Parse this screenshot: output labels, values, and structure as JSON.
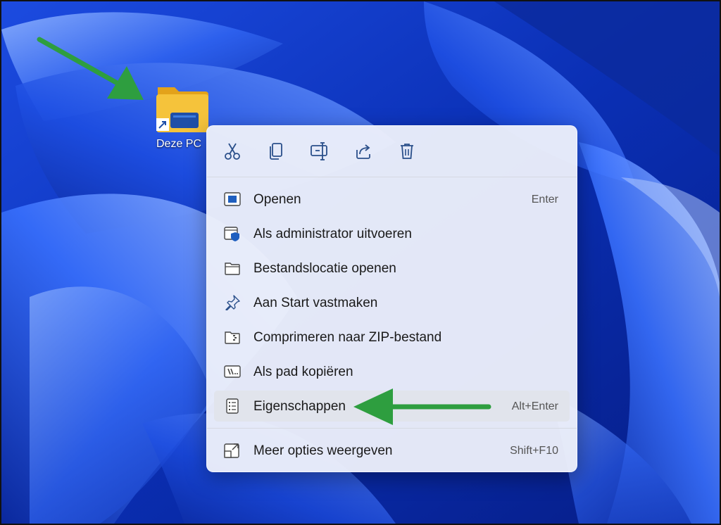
{
  "desktop": {
    "icon_label": "Deze PC"
  },
  "context_menu": {
    "toolbar": [
      {
        "name": "cut-icon"
      },
      {
        "name": "copy-icon"
      },
      {
        "name": "rename-icon"
      },
      {
        "name": "share-icon"
      },
      {
        "name": "delete-icon"
      }
    ],
    "items": [
      {
        "label": "Openen",
        "shortcut": "Enter",
        "icon": "open-window-icon"
      },
      {
        "label": "Als administrator uitvoeren",
        "shortcut": "",
        "icon": "shield-window-icon"
      },
      {
        "label": "Bestandslocatie openen",
        "shortcut": "",
        "icon": "folder-icon"
      },
      {
        "label": "Aan Start vastmaken",
        "shortcut": "",
        "icon": "pin-icon"
      },
      {
        "label": "Comprimeren naar ZIP-bestand",
        "shortcut": "",
        "icon": "zip-folder-icon"
      },
      {
        "label": "Als pad kopiëren",
        "shortcut": "",
        "icon": "copy-path-icon"
      },
      {
        "label": "Eigenschappen",
        "shortcut": "Alt+Enter",
        "icon": "properties-icon",
        "highlighted": true
      },
      {
        "label": "Meer opties weergeven",
        "shortcut": "Shift+F10",
        "icon": "more-options-icon"
      }
    ]
  },
  "colors": {
    "wallpaper_base": "#0b2fae",
    "menu_background": "#eceffa",
    "annotation_arrow": "#2e9e3f",
    "accent": "#0067c0"
  }
}
